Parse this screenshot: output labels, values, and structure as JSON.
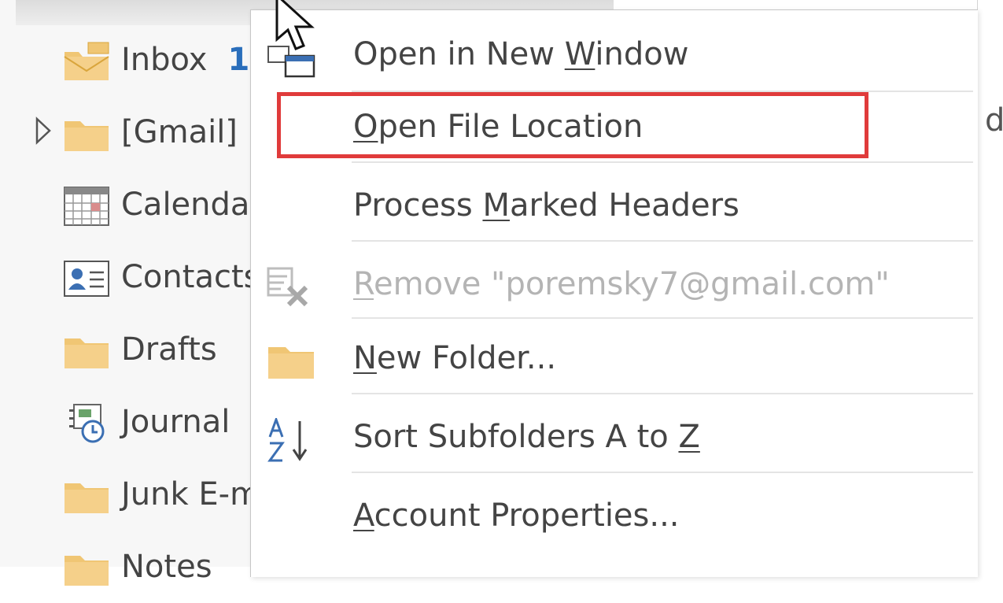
{
  "folders": [
    {
      "label": "Inbox",
      "count": "1",
      "icon": "envelope-folder-icon"
    },
    {
      "label": "[Gmail]",
      "icon": "folder-icon",
      "expandable": true
    },
    {
      "label": "Calendar",
      "icon": "calendar-icon"
    },
    {
      "label": "Contacts",
      "icon": "contacts-icon"
    },
    {
      "label": "Drafts",
      "icon": "folder-icon"
    },
    {
      "label": "Journal",
      "icon": "journal-icon"
    },
    {
      "label": "Junk E-mail",
      "icon": "folder-icon"
    },
    {
      "label": "Notes",
      "icon": "folder-icon"
    }
  ],
  "right_fragment": "d",
  "menu": [
    {
      "pre": "Open in New ",
      "ul": "W",
      "post": "indow",
      "icon": "new-window-icon",
      "enabled": true
    },
    {
      "pre": "",
      "ul": "O",
      "post": "pen File Location",
      "icon": "",
      "enabled": true,
      "highlighted": true
    },
    {
      "pre": "Process ",
      "ul": "M",
      "post": "arked Headers",
      "icon": "",
      "enabled": true
    },
    {
      "pre": "",
      "ul": "R",
      "post": "emove \"poremsky7@gmail.com\"",
      "icon": "remove-account-icon",
      "enabled": false
    },
    {
      "pre": "",
      "ul": "N",
      "post": "ew Folder...",
      "icon": "folder-icon",
      "enabled": true
    },
    {
      "pre": "Sort Subfolders A to ",
      "ul": "Z",
      "post": "",
      "icon": "sort-az-icon",
      "enabled": true
    },
    {
      "pre": "",
      "ul": "A",
      "post": "ccount Properties...",
      "icon": "",
      "enabled": true
    }
  ],
  "colors": {
    "highlight": "#e03b3b",
    "folder": "#f0c674",
    "accent": "#2a6ebb"
  }
}
